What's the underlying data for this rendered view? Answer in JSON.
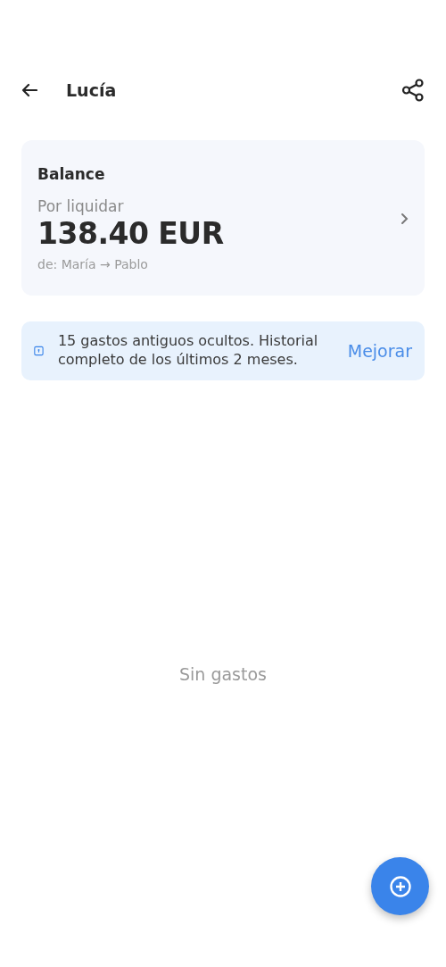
{
  "header": {
    "title": "Lucía"
  },
  "balance": {
    "title": "Balance",
    "label": "Por liquidar",
    "amount": "138.40 EUR",
    "detail": "de: María → Pablo"
  },
  "notice": {
    "text": "15 gastos antiguos ocultos. Historial completo de los últimos 2 meses.",
    "action": "Mejorar"
  },
  "empty_state": "Sin gastos"
}
